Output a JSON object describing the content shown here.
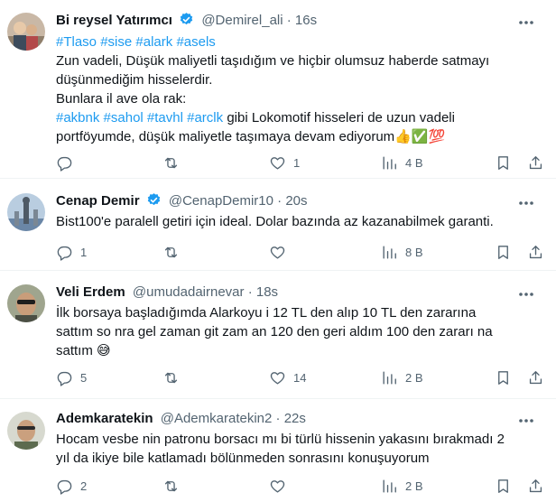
{
  "tweets": [
    {
      "name": "Bi reysel Yatırımcı",
      "handle": "@Demirel_ali",
      "sep": "·",
      "time": "16s",
      "hashtags_line": [
        "#Tlaso",
        "#sise",
        "#alark",
        "#asels"
      ],
      "line1": "Zun vadeli, Düşük maliyetli  taşıdığım ve hiçbir olumsuz haberde satmayı",
      "line2": "düşünmediğim hisselerdir.",
      "line3": "Bunlara il ave ola rak:",
      "line4_tags": [
        "#akbnk",
        "#sahol",
        "#tavhl",
        "#arclk"
      ],
      "line4_text": "gibi Lokomotif hisseleri de uzun vadeli",
      "line5": "portföyumde, düşük maliyetle taşımaya devam ediyorum",
      "line5_emojis": "👍✅💯",
      "replies": "",
      "reposts": "",
      "likes": "1",
      "views": "4 B"
    },
    {
      "name": "Cenap Demir",
      "handle": "@CenapDemir10",
      "sep": "·",
      "time": "20s",
      "line1": "Bist100'e paralell getiri için ideal. Dolar bazında az kazanabilmek garanti.",
      "replies": "1",
      "reposts": "",
      "likes": "",
      "views": "8 B"
    },
    {
      "name": "Veli Erdem",
      "handle": "@umudadairnevar",
      "sep": "·",
      "time": "18s",
      "line1": "İlk borsaya başladığımda Alarkoyu i 12  TL den  alıp  10 TL den zararına",
      "line2": "sattım so nra gel  zaman  git zam an 120  den geri aldım  100 den zararı na",
      "line3": "sattım",
      "line3_emoji": "😅",
      "replies": "5",
      "reposts": "",
      "likes": "14",
      "views": "2 B"
    },
    {
      "name": "Ademkaratekin",
      "handle": "@Ademkaratekin2",
      "sep": "·",
      "time": "22s",
      "line1": "Hocam vesbe nin patronu borsacı mı bi türlü hissenin yakasını bırakmadı 2",
      "line2": "yıl da ikiye bile katlamadı bölünmeden  sonrasını konuşuyorum",
      "replies": "2",
      "reposts": "",
      "likes": "",
      "views": "2 B"
    }
  ],
  "icons": {
    "reply": "reply-icon",
    "repost": "repost-icon",
    "like": "like-icon",
    "views": "views-icon",
    "bookmark": "bookmark-icon",
    "share": "share-icon",
    "verified": "verified-badge-icon",
    "more": "more-icon"
  },
  "colors": {
    "link": "#1d9bf0",
    "muted": "#536471",
    "verified": "#1d9bf0"
  }
}
